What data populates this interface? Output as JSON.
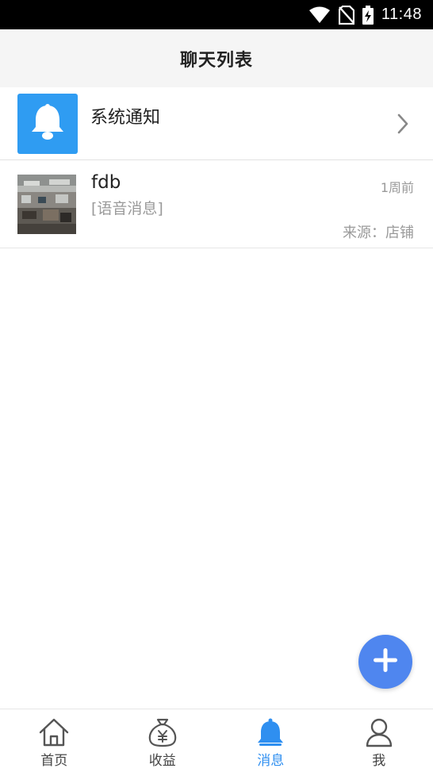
{
  "status_bar": {
    "time": "11:48",
    "icons": [
      "wifi-icon",
      "no-sim-icon",
      "battery-charging-icon"
    ]
  },
  "header": {
    "title": "聊天列表"
  },
  "system_notice": {
    "label": "系统通知",
    "icon": "bell-icon",
    "icon_bg_color": "#2f9cf2"
  },
  "chats": [
    {
      "name": "fdb",
      "preview": "[语音消息]",
      "time": "1周前",
      "source": "来源：店铺"
    }
  ],
  "fab": {
    "icon": "plus-icon",
    "color": "#4f86ef"
  },
  "bottom_nav": {
    "active_color": "#2f8ff0",
    "items": [
      {
        "label": "首页",
        "icon": "home-icon"
      },
      {
        "label": "收益",
        "icon": "money-bag-icon"
      },
      {
        "label": "消息",
        "icon": "bell-icon",
        "active": true
      },
      {
        "label": "我",
        "icon": "person-icon"
      }
    ]
  }
}
